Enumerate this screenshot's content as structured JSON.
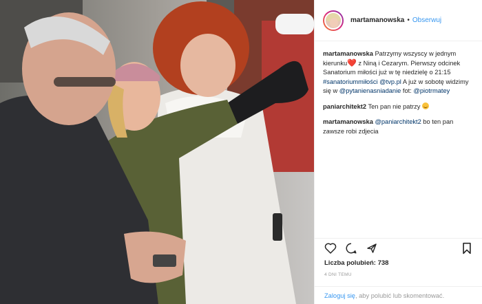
{
  "post": {
    "photo_alt": "Patrzymy wszyscy w jednym kierunku",
    "author": "martamanowska",
    "separator": "•",
    "follow_label": "Obserwuj"
  },
  "comments": [
    {
      "user": "martamanowska",
      "text_1": " Patrzymy wszyscy w jednym kierunku",
      "heart": "❤️",
      "text_2": " z Niną i Cezarym. Pierwszy odcinek Sanatorium miłości już w tę niedzielę o 21:15 ",
      "hashtag": "#sanatoriummiłości",
      "space_1": " ",
      "mention_1": "@tvp.pl",
      "text_3": " A już w sobotę widzimy się w ",
      "mention_2": "@pytanienasniadanie",
      "text_4": " fot: ",
      "mention_3": "@piotrmatey"
    },
    {
      "user": "paniarchitekt2",
      "text": " Ten pan nie patrzy",
      "emoji": "smiling-face"
    },
    {
      "user": "martamanowska",
      "mention": "@paniarchitekt2",
      "text": " bo ten pan zawsze robi zdjecia"
    }
  ],
  "actions": {
    "like_icon": "heart-outline-icon",
    "comment_icon": "comment-bubble-icon",
    "share_icon": "share-arrow-icon",
    "save_icon": "bookmark-icon"
  },
  "likes": {
    "label": "Liczba polubień:",
    "count": "738"
  },
  "timestamp": "4 DNI TEMU",
  "login": {
    "link": "Zaloguj się",
    "rest": ", aby polubić lub skomentować."
  },
  "colors": {
    "link_blue": "#3897f0",
    "mention_blue": "#003569",
    "text": "#262626",
    "muted": "#999999",
    "heart_red": "#ed4956"
  }
}
